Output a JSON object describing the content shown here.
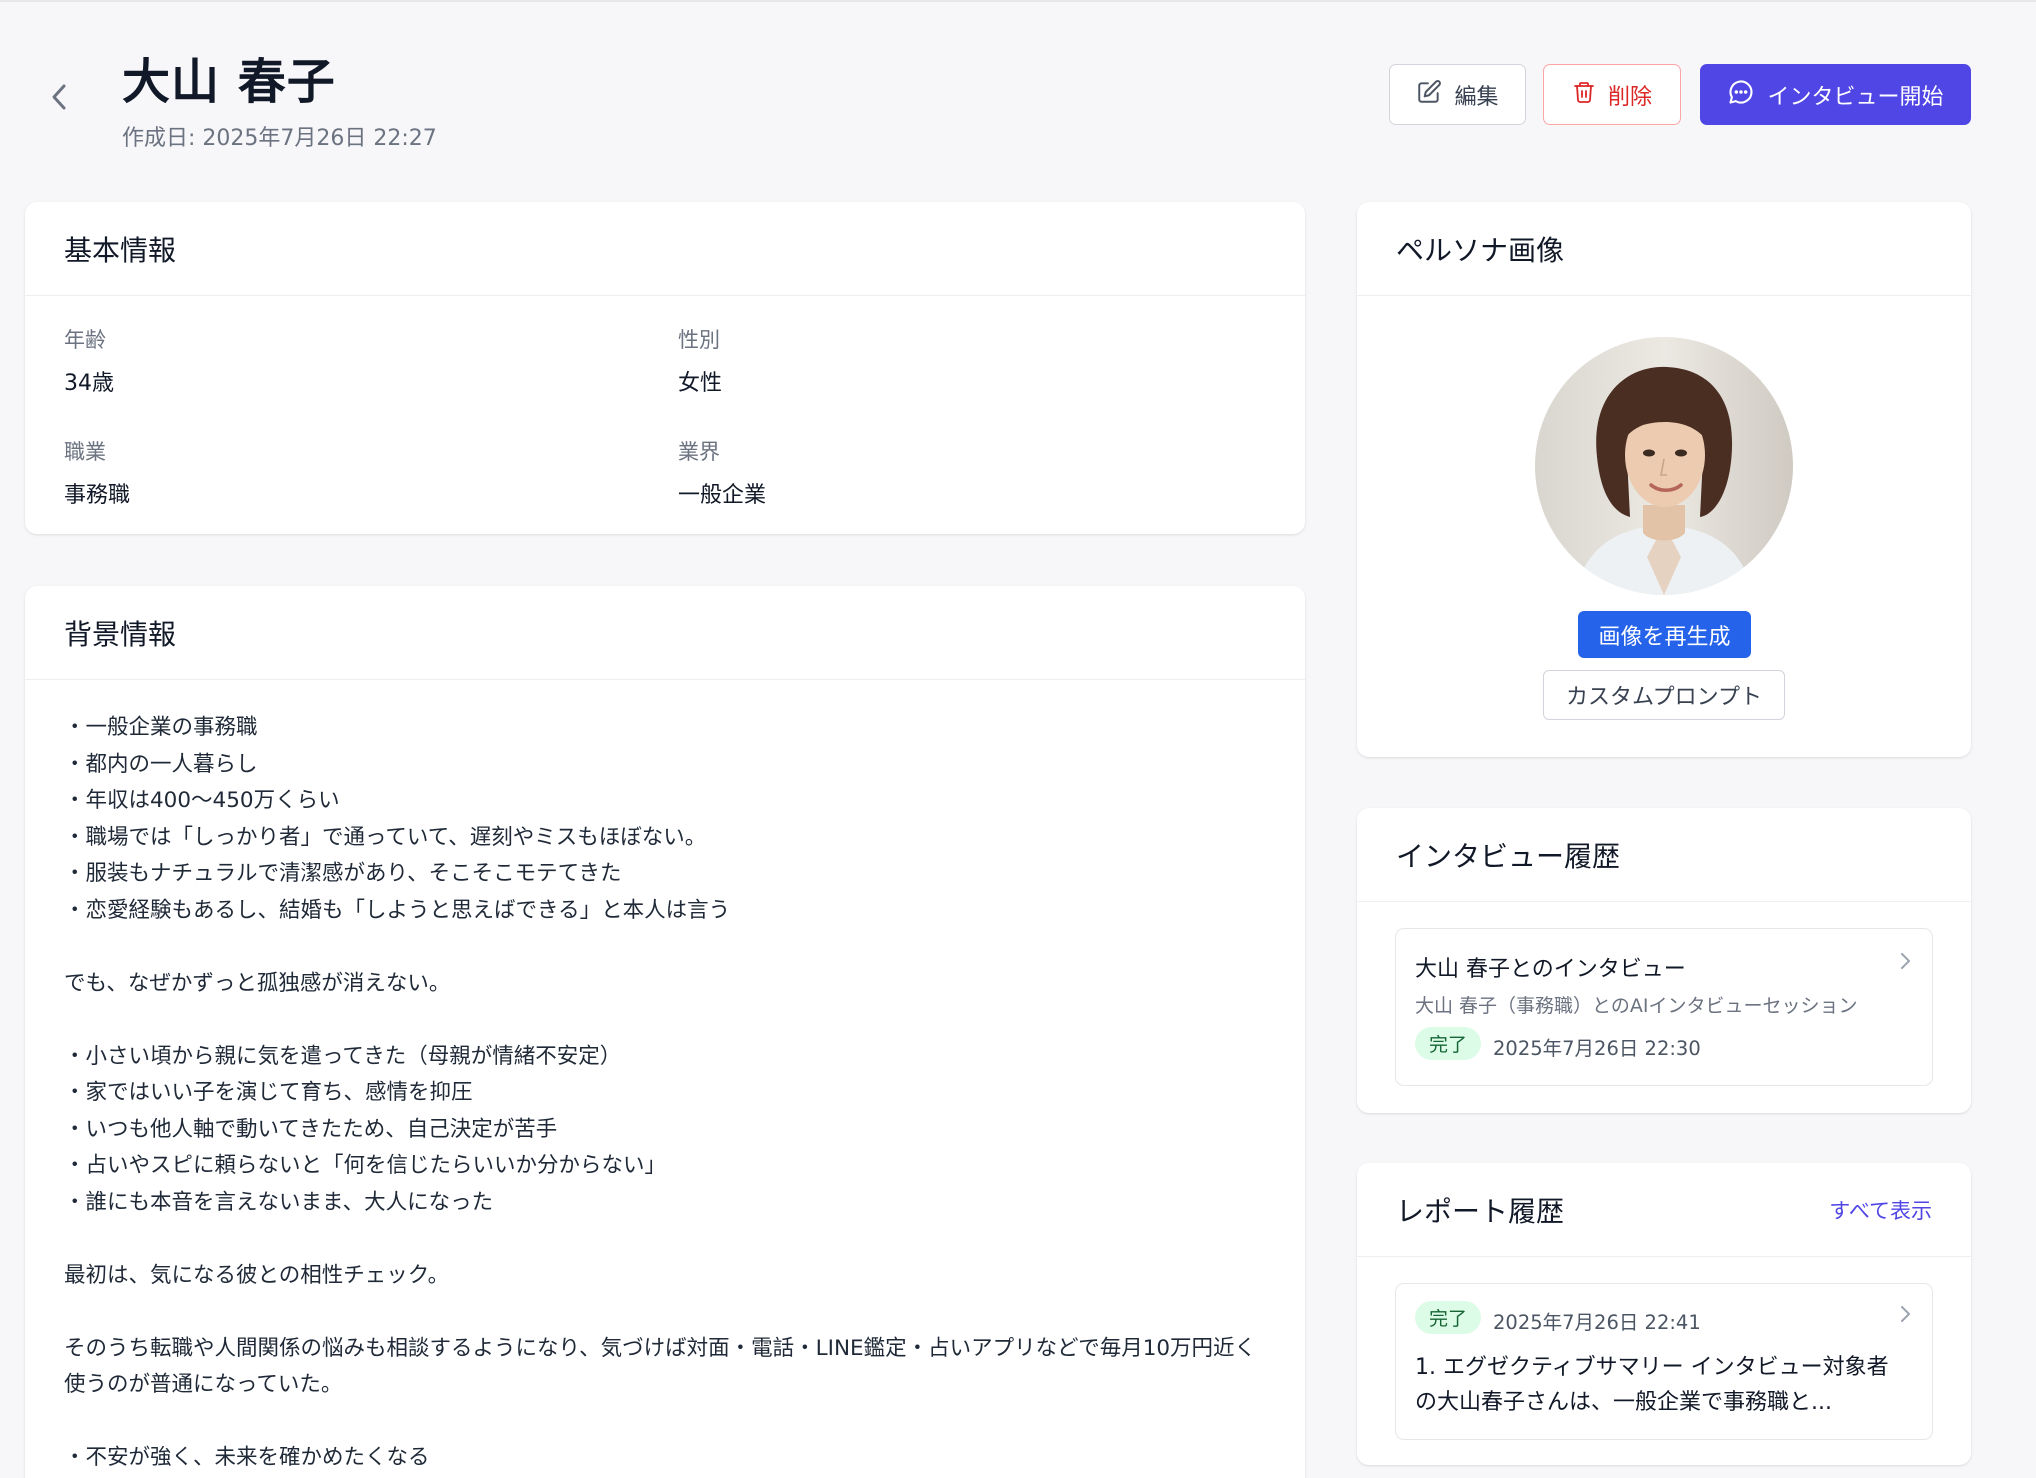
{
  "header": {
    "title": "大山 春子",
    "created": "作成日: 2025年7月26日 22:27",
    "edit_label": "編集",
    "delete_label": "削除",
    "interview_label": "インタビュー開始"
  },
  "basic": {
    "title": "基本情報",
    "age_label": "年齢",
    "age_value": "34歳",
    "gender_label": "性別",
    "gender_value": "女性",
    "job_label": "職業",
    "job_value": "事務職",
    "industry_label": "業界",
    "industry_value": "一般企業"
  },
  "background": {
    "title": "背景情報",
    "text": "・一般企業の事務職\n・都内の一人暮らし\n・年収は400〜450万くらい\n・職場では「しっかり者」で通っていて、遅刻やミスもほぼない。\n・服装もナチュラルで清潔感があり、そこそこモテてきた\n・恋愛経験もあるし、結婚も「しようと思えばできる」と本人は言う\n\nでも、なぜかずっと孤独感が消えない。\n\n・小さい頃から親に気を遣ってきた（母親が情緒不安定）\n・家ではいい子を演じて育ち、感情を抑圧\n・いつも他人軸で動いてきたため、自己決定が苦手\n・占いやスピに頼らないと「何を信じたらいいか分からない」\n・誰にも本音を言えないまま、大人になった\n\n最初は、気になる彼との相性チェック。\n\nそのうち転職や人間関係の悩みも相談するようになり、気づけば対面・電話・LINE鑑定・占いアプリなどで毎月10万円近く使うのが普通になっていた。\n\n・不安が強く、未来を確かめたくなる"
  },
  "persona": {
    "title": "ペルソナ画像",
    "regen_label": "画像を再生成",
    "custom_label": "カスタムプロンプト"
  },
  "history": {
    "title": "インタビュー履歴",
    "items": [
      {
        "title": "大山 春子とのインタビュー",
        "subtitle": "大山 春子（事務職）とのAIインタビューセッション",
        "status": "完了",
        "date": "2025年7月26日 22:30"
      }
    ]
  },
  "reports": {
    "title": "レポート履歴",
    "view_all": "すべて表示",
    "items": [
      {
        "status": "完了",
        "date": "2025年7月26日 22:41",
        "snippet": "1. エグゼクティブサマリー インタビュー対象者の大山春子さんは、一般企業で事務職と..."
      }
    ]
  },
  "colors": {
    "primary": "#4f46e5",
    "danger": "#dc2626",
    "regen": "#2563eb",
    "success_bg": "#dcfce7"
  }
}
